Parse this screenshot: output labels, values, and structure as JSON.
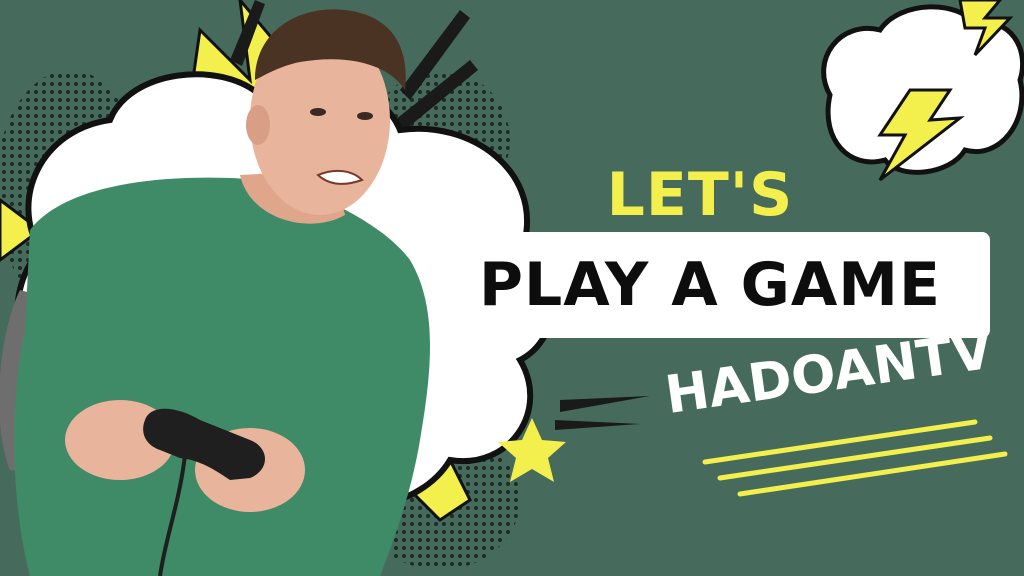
{
  "headline": {
    "lets": "LET'S",
    "main": "PLAY A GAME"
  },
  "brand": {
    "name": "HADOANTV"
  },
  "colors": {
    "background": "#466b5d",
    "accent_yellow": "#f3ef4c",
    "banner": "#ffffff",
    "shirt": "#3f8a67",
    "sleeve": "#6e6e6e",
    "skin": "#e8b49b"
  },
  "icons": [
    "lightning-bolt-icon",
    "star-icon",
    "burst-icon",
    "storm-cloud-icon",
    "game-controller-icon"
  ]
}
